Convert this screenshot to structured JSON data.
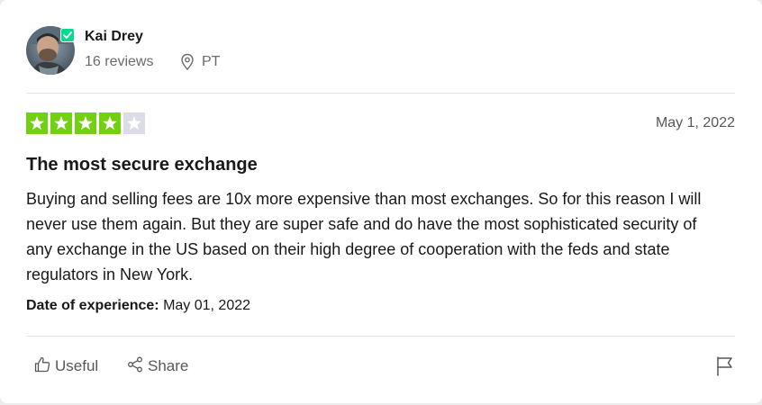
{
  "review": {
    "author": {
      "name": "Kai Drey",
      "reviews_count": "16 reviews",
      "country": "PT",
      "verified": true,
      "avatar_icon": "user-photo"
    },
    "rating": {
      "value": 4,
      "max": 5,
      "filled_color": "#73cf11",
      "empty_color": "#dcdce6"
    },
    "date": "May 1, 2022",
    "title": "The most secure exchange",
    "text": "Buying and selling fees are 10x more expensive than most exchanges. So for this reason I will never use them again. But they are super safe and do have the most sophisticated security of any exchange in the US based on their high degree of cooperation with the feds and state regulators in New York.",
    "experience": {
      "label": "Date of experience:",
      "value": "May 01, 2022"
    },
    "actions": {
      "useful_label": "Useful",
      "share_label": "Share",
      "useful_icon": "thumbs-up-icon",
      "share_icon": "share-icon",
      "flag_icon": "flag-icon"
    }
  }
}
